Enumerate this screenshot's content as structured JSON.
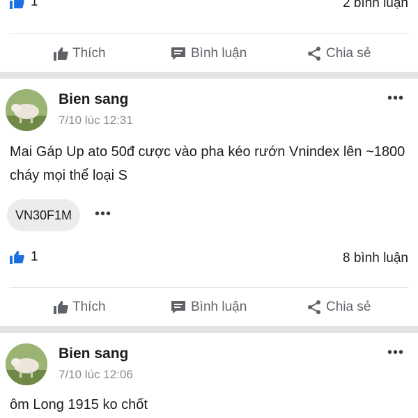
{
  "top_post": {
    "like_count": "1",
    "comment_count": "2 bình luận"
  },
  "actions": {
    "like": "Thích",
    "comment": "Bình luận",
    "share": "Chia sẻ"
  },
  "posts": [
    {
      "author": "Bien sang",
      "time": "7/10 lúc 12:31",
      "content": "Mai Gáp Up ato 50đ cược vào pha kéo rướn Vnindex lên ~1800 cháy mọi thể loại S",
      "tag": "VN30F1M",
      "like_count": "1",
      "comment_count": "8 bình luận"
    },
    {
      "author": "Bien sang",
      "time": "7/10 lúc 12:06",
      "content": "ôm Long 1915 ko chốt"
    }
  ],
  "icons": {
    "like": "thumbs-up-icon",
    "comment": "comment-bubble-icon",
    "share": "share-icon",
    "more": "more-dots-icon"
  },
  "colors": {
    "like_blue": "#1e6fe0",
    "action_gray": "#5f6368",
    "separator": "#e3e3e5"
  }
}
